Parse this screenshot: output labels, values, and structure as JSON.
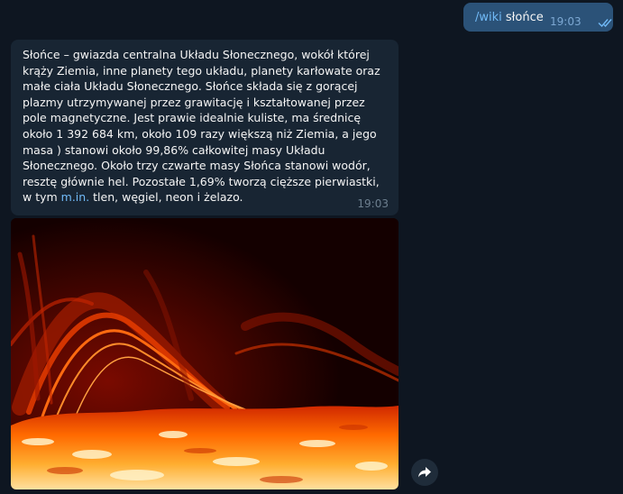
{
  "outgoing": {
    "command": "/wiki",
    "text": "słońce",
    "time": "19:03",
    "status_icon": "double-check-icon"
  },
  "incoming": {
    "text_before_link": "Słońce – gwiazda centralna Układu Słonecznego, wokół której krąży Ziemia, inne planety tego układu, planety karłowate oraz małe ciała Układu Słonecznego. Słońce składa się z gorącej plazmy utrzymywanej przez grawitację i kształtowanej przez pole magnetyczne. Jest prawie idealnie kuliste, ma średnicę około 1 392 684 km, około 109 razy większą niż Ziemia, a jego masa ) stanowi około 99,86% całkowitej masy Układu Słonecznego. Około trzy czwarte masy Słońca stanowi wodór, resztę głównie hel. Pozostałe 1,69% tworzą cięższe pierwiastki, w tym ",
    "link": "m.in.",
    "text_after_link": " tlen, węgiel, neon i żelazo.",
    "time": "19:03"
  },
  "photo": {
    "subject": "solar-prominence-photo",
    "colors": {
      "dark": "#1a0000",
      "mid": "#c81e00",
      "hot": "#ff7a00",
      "bright": "#ffd27a"
    }
  },
  "forward_button": {
    "icon": "forward-arrow-icon"
  }
}
